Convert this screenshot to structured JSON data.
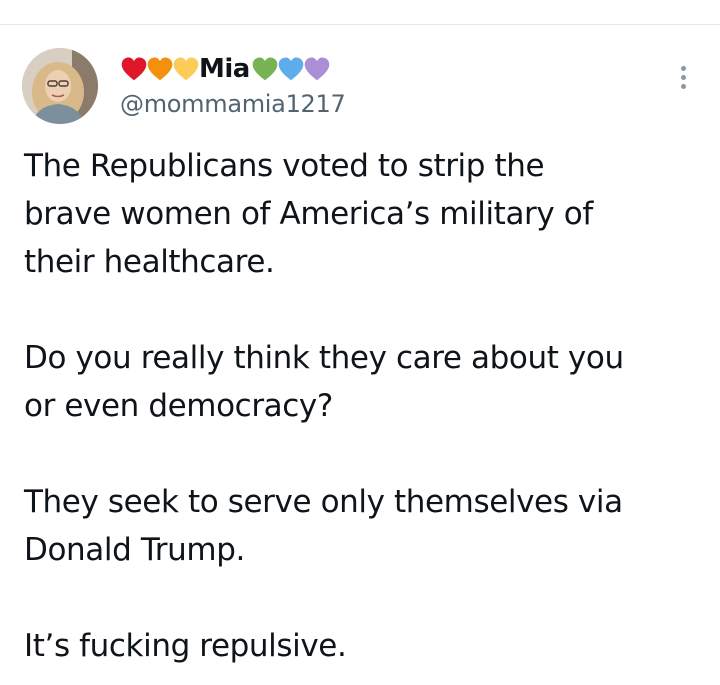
{
  "tweet": {
    "author": {
      "name": "Mia",
      "name_prefix_emojis": [
        "red-heart",
        "orange-heart",
        "yellow-heart"
      ],
      "name_suffix_emojis": [
        "green-heart",
        "blue-heart",
        "purple-heart"
      ],
      "handle": "@mommamia1217",
      "avatar": "avatar-photo"
    },
    "paragraphs": [
      "The Republicans voted to strip the\nbrave women of America’s military of\ntheir healthcare.",
      "Do you really think they care about you\nor even democracy?",
      "They seek to serve only themselves via\nDonald Trump.",
      "It’s fucking repulsive."
    ],
    "more_menu_icon": "more-vertical-icon"
  },
  "colors": {
    "red_heart": "#e0162b",
    "orange_heart": "#f4900c",
    "yellow_heart": "#fdcb58",
    "green_heart": "#77b255",
    "blue_heart": "#5dadec",
    "purple_heart": "#aa8ed6",
    "text": "#0f1419",
    "secondary_text": "#536471"
  }
}
